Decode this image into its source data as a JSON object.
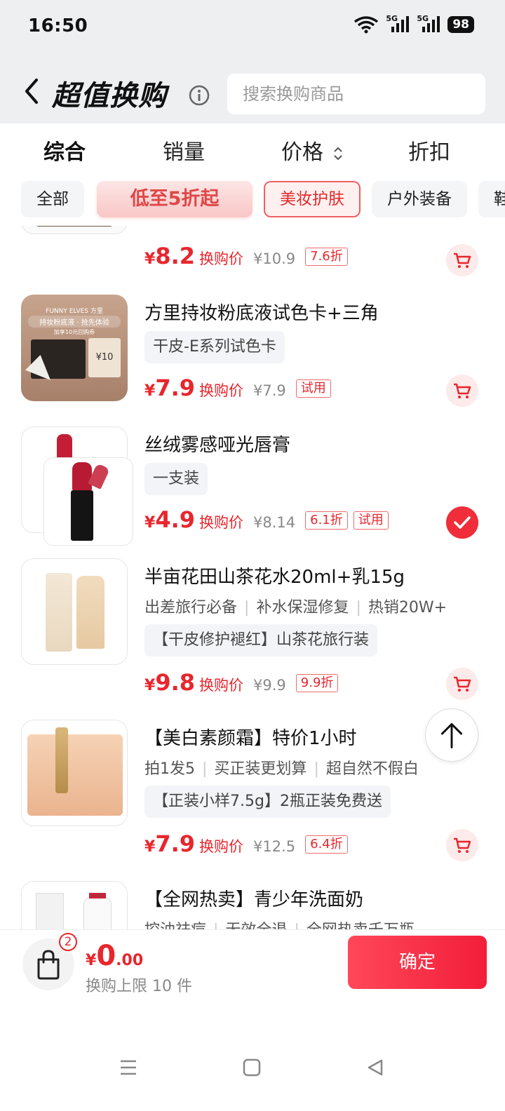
{
  "status_bar": {
    "time": "16:50",
    "network_1": "5G",
    "network_2": "5G",
    "battery": "98",
    "icons": [
      "wifi-icon",
      "signal-icon",
      "signal-icon",
      "battery-icon"
    ]
  },
  "header": {
    "title": "超值换购",
    "search_placeholder": "搜索换购商品"
  },
  "sort_tabs": [
    {
      "label": "综合",
      "active": true
    },
    {
      "label": "销量",
      "active": false
    },
    {
      "label": "价格",
      "active": false
    },
    {
      "label": "折扣",
      "active": false
    }
  ],
  "filter_chips": [
    {
      "label": "全部"
    },
    {
      "label": "低至5折起"
    },
    {
      "label": "美妆护肤",
      "selected": true
    },
    {
      "label": "户外装备"
    },
    {
      "label": "鞋"
    }
  ],
  "products": [
    {
      "price_currency": "¥",
      "price": "8.2",
      "price_label": "换购价",
      "original_price": "¥10.9",
      "badges": [
        "7.6折"
      ],
      "in_cart": false
    },
    {
      "name": "方里持妆粉底液试色卡+三角",
      "tag": "干皮-E系列试色卡",
      "price_currency": "¥",
      "price": "7.9",
      "price_label": "换购价",
      "original_price": "¥7.9",
      "badges": [
        "试用"
      ],
      "in_cart": false,
      "thumb_text": [
        "FUNNY ELVES 方里",
        "持妆粉底液 · 抢先体验",
        "加享10元回购券",
        "¥10"
      ]
    },
    {
      "name": "丝绒雾感哑光唇膏",
      "tag": "一支装",
      "price_currency": "¥",
      "price": "4.9",
      "price_label": "换购价",
      "original_price": "¥8.14",
      "badges": [
        "6.1折",
        "试用"
      ],
      "in_cart": true
    },
    {
      "name": "半亩花田山茶花水20ml+乳15g",
      "features": [
        "出差旅行必备",
        "补水保湿修复",
        "热销20W+"
      ],
      "tag": "【干皮修护褪红】山茶花旅行装",
      "price_currency": "¥",
      "price": "9.8",
      "price_label": "换购价",
      "original_price": "¥9.9",
      "badges": [
        "9.9折"
      ],
      "in_cart": false
    },
    {
      "name": "【美白素颜霜】特价1小时",
      "features": [
        "拍1发5",
        "买正装更划算",
        "超自然不假白"
      ],
      "tag": "【正装小样7.5g】2瓶正装免费送",
      "price_currency": "¥",
      "price": "7.9",
      "price_label": "换购价",
      "original_price": "¥12.5",
      "badges": [
        "6.4折"
      ],
      "in_cart": false
    },
    {
      "name": "【全网热卖】青少年洗面奶",
      "features": [
        "控油祛痘",
        "无效全退",
        "全网热卖千万瓶"
      ]
    }
  ],
  "bottom_bar": {
    "cart_count": "2",
    "total_currency": "¥",
    "total_int": "0",
    "total_dec": ".00",
    "limit_text": "换购上限 10 件",
    "confirm_label": "确定"
  },
  "colors": {
    "accent": "#e8262d",
    "header_bg": "#eeeff1",
    "confirm_gradient": [
      "#ff4758",
      "#f21e3a"
    ]
  }
}
